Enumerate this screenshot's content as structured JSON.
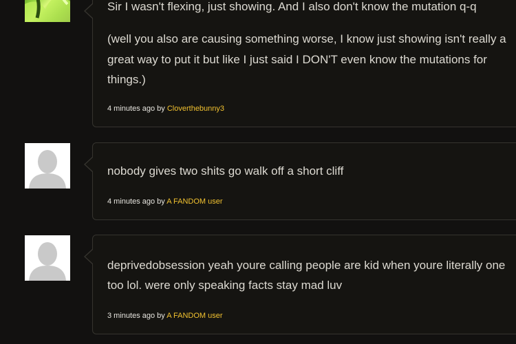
{
  "comments": [
    {
      "avatar": "custom-user-avatar",
      "paragraphs": [
        "Sir I wasn't flexing, just showing. And I also don't know the mutation q-q",
        "(well you also are causing something worse, I know just showing isn't really a",
        "great way to put it but like I just said I DON'T even know the mutations for",
        "things.)"
      ],
      "time": "4 minutes ago",
      "by": "by",
      "user": "Cloverthebunny3"
    },
    {
      "avatar": "default-user-avatar",
      "paragraphs": [
        "nobody gives two shits go walk off a short cliff"
      ],
      "time": "4 minutes ago",
      "by": "by",
      "user": "A FANDOM user"
    },
    {
      "avatar": "default-user-avatar",
      "paragraphs": [
        "deprivedobsession yeah youre calling people are kid when youre literally one",
        "too lol. were only speaking facts stay mad luv"
      ],
      "time": "3 minutes ago",
      "by": "by",
      "user": "A FANDOM user"
    }
  ]
}
